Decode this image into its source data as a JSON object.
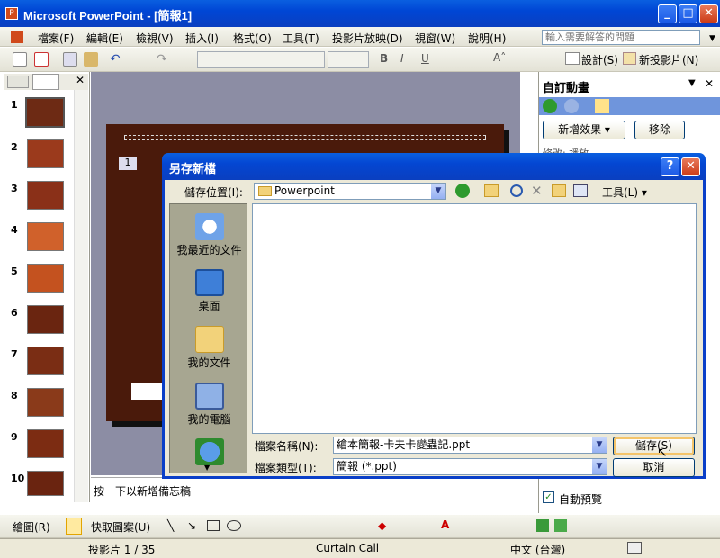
{
  "app": {
    "title": "Microsoft PowerPoint - [簡報1]",
    "icon": "powerpoint-icon"
  },
  "menu": [
    "檔案(F)",
    "編輯(E)",
    "檢視(V)",
    "插入(I)",
    "格式(O)",
    "工具(T)",
    "投影片放映(D)",
    "視窗(W)",
    "說明(H)"
  ],
  "help_placeholder": "輸入需要解答的問題",
  "toolbar": {
    "design": "設計(S)",
    "new_slide": "新投影片(N)"
  },
  "slides": [
    "1",
    "2",
    "3",
    "4",
    "5",
    "6",
    "7",
    "8",
    "9",
    "10"
  ],
  "slide_number_tag": "1",
  "notes_placeholder": "按一下以新增備忘稿",
  "taskpane": {
    "title": "自訂動畫",
    "add_effect": "新增效果",
    "remove": "移除",
    "modify": "修改: 播放",
    "auto_preview": "自動預覽"
  },
  "drawbar": {
    "draw": "繪圖(R)",
    "autoshapes": "快取圖案(U)"
  },
  "status": {
    "slide": "投影片 1 / 35",
    "design": "Curtain Call",
    "lang": "中文 (台灣)"
  },
  "dialog": {
    "title": "另存新檔",
    "save_in_label": "儲存位置(I):",
    "save_in_value": "Powerpoint",
    "tools": "工具(L)",
    "places": [
      "我最近的文件",
      "桌面",
      "我的文件",
      "我的電腦"
    ],
    "filename_label": "檔案名稱(N):",
    "filename_value": "繪本簡報-卡夫卡變蟲記.ppt",
    "filetype_label": "檔案類型(T):",
    "filetype_value": "簡報 (*.ppt)",
    "save": "儲存(S)",
    "cancel": "取消"
  }
}
